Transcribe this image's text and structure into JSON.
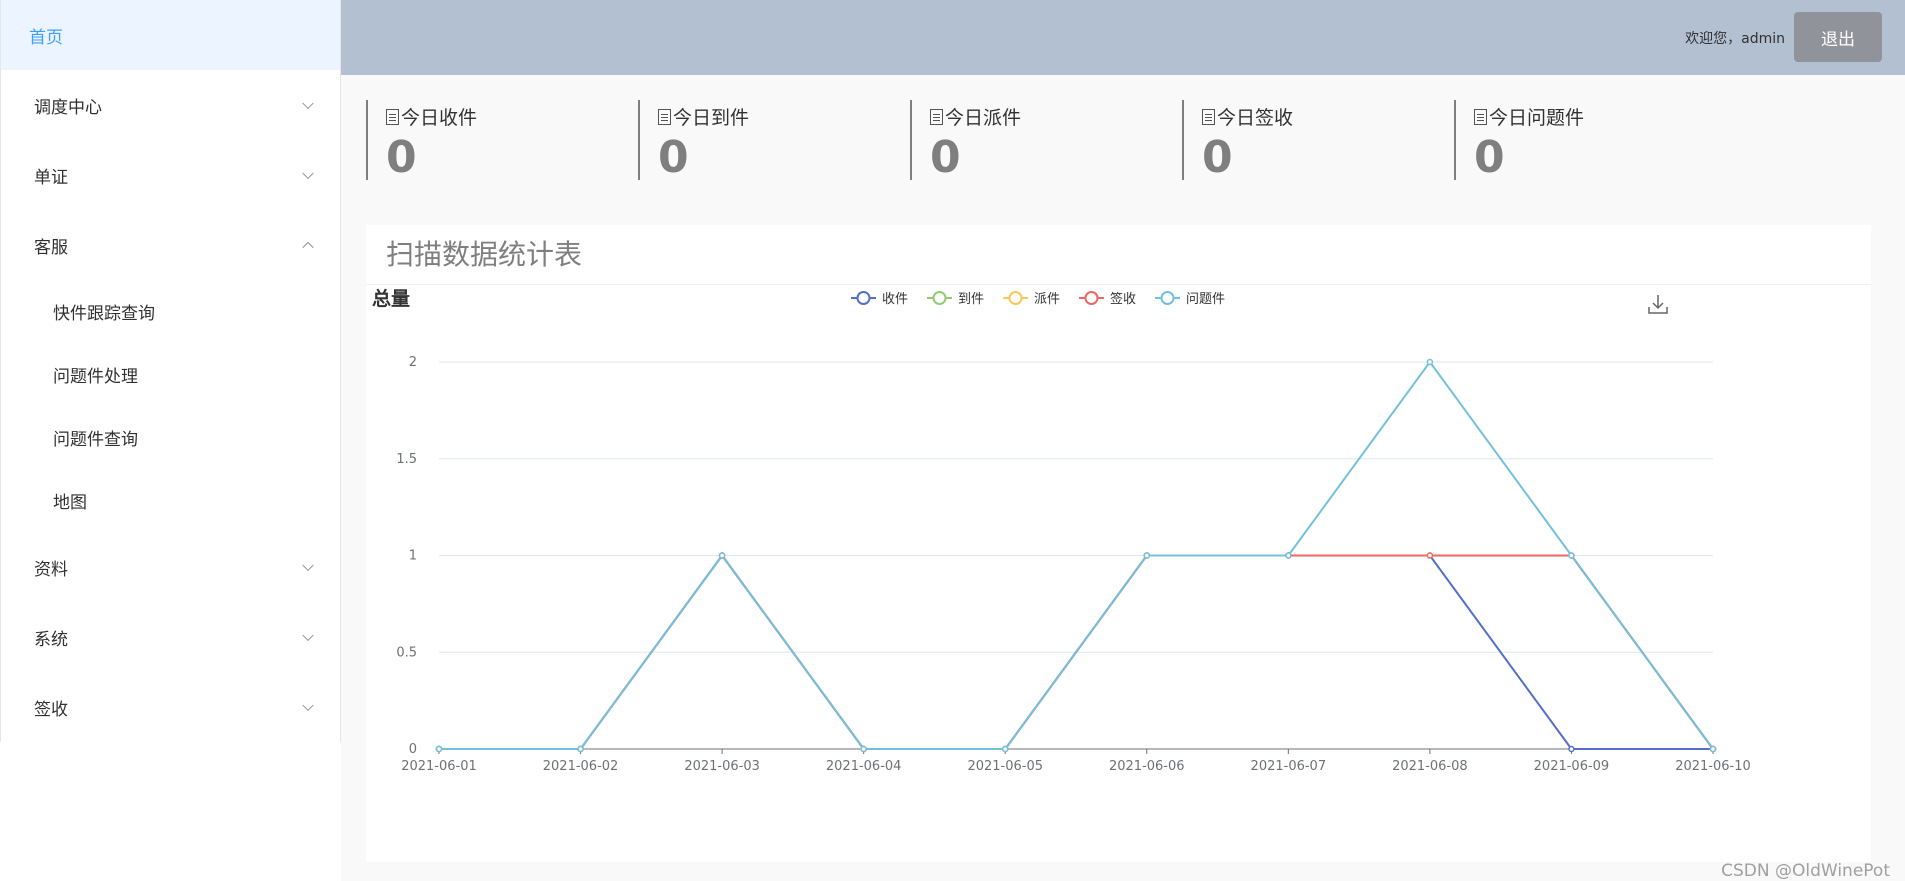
{
  "sidebar": {
    "items": [
      {
        "label": "首页",
        "active": true
      },
      {
        "label": "调度中心",
        "expanded": false
      },
      {
        "label": "单证",
        "expanded": false
      },
      {
        "label": "客服",
        "expanded": true,
        "children": [
          "快件跟踪查询",
          "问题件处理",
          "问题件查询",
          "地图"
        ]
      },
      {
        "label": "资料",
        "expanded": false
      },
      {
        "label": "系统",
        "expanded": false
      },
      {
        "label": "签收",
        "expanded": false
      }
    ]
  },
  "header": {
    "welcome": "欢迎您，admin",
    "logout_label": "退出"
  },
  "stats": [
    {
      "label": "今日收件",
      "value": "0"
    },
    {
      "label": "今日到件",
      "value": "0"
    },
    {
      "label": "今日派件",
      "value": "0"
    },
    {
      "label": "今日签收",
      "value": "0"
    },
    {
      "label": "今日问题件",
      "value": "0"
    }
  ],
  "panel": {
    "title": "扫描数据统计表"
  },
  "chart_data": {
    "type": "line",
    "title": "总量",
    "x": [
      "2021-06-01",
      "2021-06-02",
      "2021-06-03",
      "2021-06-04",
      "2021-06-05",
      "2021-06-06",
      "2021-06-07",
      "2021-06-08",
      "2021-06-09",
      "2021-06-10"
    ],
    "ylim": [
      0,
      2
    ],
    "yticks": [
      0,
      0.5,
      1,
      1.5,
      2
    ],
    "grid": true,
    "legend_position": "top-center",
    "series": [
      {
        "name": "收件",
        "color": "#5470c6",
        "values": [
          0,
          0,
          1,
          0,
          0,
          1,
          1,
          1,
          0,
          0
        ]
      },
      {
        "name": "到件",
        "color": "#91cc75",
        "values": [
          0,
          0,
          1,
          0,
          0,
          1,
          1,
          1,
          1,
          0
        ]
      },
      {
        "name": "派件",
        "color": "#fac858",
        "values": [
          0,
          0,
          1,
          0,
          0,
          1,
          1,
          1,
          1,
          0
        ]
      },
      {
        "name": "签收",
        "color": "#ee6666",
        "values": [
          0,
          0,
          1,
          0,
          0,
          1,
          1,
          1,
          1,
          0
        ]
      },
      {
        "name": "问题件",
        "color": "#73c0de",
        "values": [
          0,
          0,
          1,
          0,
          0,
          1,
          1,
          2,
          1,
          0
        ]
      }
    ],
    "toolbox": "download-icon"
  },
  "watermark": "CSDN @OldWinePot"
}
